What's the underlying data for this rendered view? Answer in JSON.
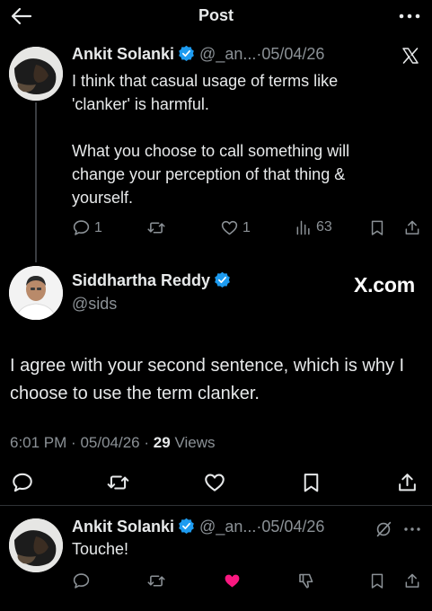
{
  "header": {
    "title": "Post"
  },
  "tweet1": {
    "author": "Ankit Solanki",
    "handle": "@_an...",
    "separator": "·",
    "date": "05/04/26",
    "paragraphs": [
      "I think that casual usage of terms like 'clanker' is harmful.",
      "What you choose to call something will change your perception of that thing & yourself."
    ],
    "stats": {
      "replies": "1",
      "likes": "1",
      "views": "63"
    }
  },
  "tweet2": {
    "author": "Siddhartha Reddy",
    "handle": "@sids",
    "source_label": "X.com",
    "text": "I agree with your second sentence, which is why I choose to use the term clanker.",
    "time": "6:01 PM",
    "separator": "·",
    "date": "05/04/26",
    "separator2": "·",
    "views_count": "29",
    "views_label": "Views"
  },
  "tweet3": {
    "author": "Ankit Solanki",
    "handle": "@_an...",
    "separator": "·",
    "date": "05/04/26",
    "text": "Touche!"
  },
  "colors": {
    "verified": "#1d9bf0",
    "liked": "#f91880",
    "muted": "#8b9196"
  }
}
